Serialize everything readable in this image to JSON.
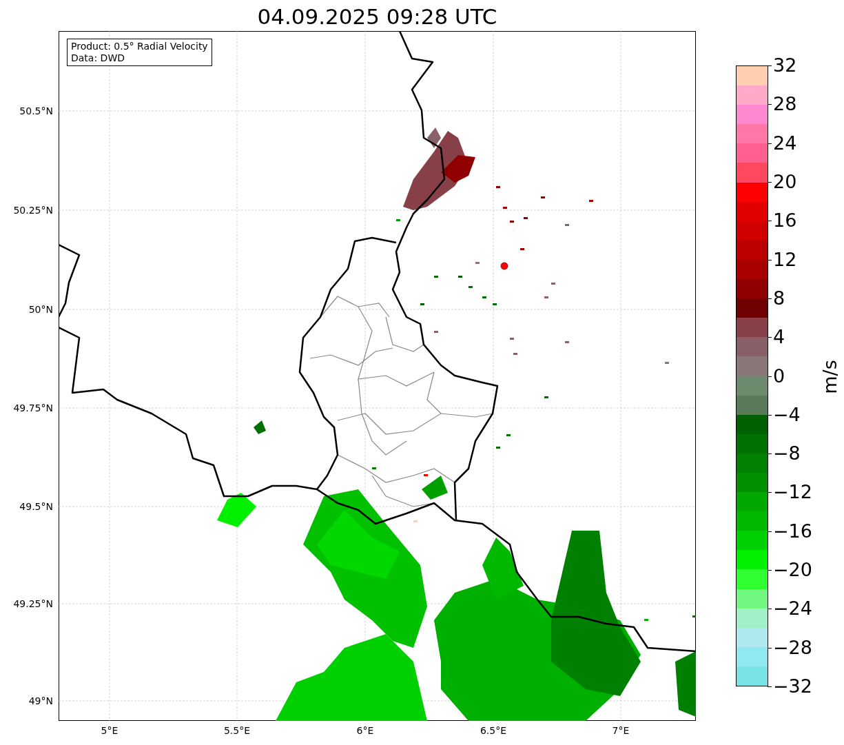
{
  "title": "04.09.2025 09:28 UTC",
  "info_box": {
    "lines": [
      "Product: 0.5° Radial Velocity",
      "Data: DWD"
    ]
  },
  "lat_labels": [
    "50.5°N",
    "50.25°N",
    "50°N",
    "49.75°N",
    "49.5°N",
    "49.25°N",
    "49°N"
  ],
  "lon_labels": [
    "5°E",
    "5.5°E",
    "6°E",
    "6.5°E",
    "7°E"
  ],
  "colorbar": {
    "label": "m/s",
    "ticks": [
      "32",
      "28",
      "24",
      "20",
      "16",
      "12",
      "8",
      "4",
      "0",
      "−4",
      "−8",
      "−12",
      "−16",
      "−20",
      "−24",
      "−28",
      "−32"
    ],
    "bands": [
      {
        "color": "#ffcfb0"
      },
      {
        "color": "#ffaac8"
      },
      {
        "color": "#ff88d0"
      },
      {
        "color": "#ff77a8"
      },
      {
        "color": "#ff6090"
      },
      {
        "color": "#ff4860"
      },
      {
        "color": "#ff0000"
      },
      {
        "color": "#e00000"
      },
      {
        "color": "#d00000"
      },
      {
        "color": "#bb0000"
      },
      {
        "color": "#a80000"
      },
      {
        "color": "#900000"
      },
      {
        "color": "#700000"
      },
      {
        "color": "#884048"
      },
      {
        "color": "#8a6068"
      },
      {
        "color": "#8a7878"
      },
      {
        "color": "#6e8a6e"
      },
      {
        "color": "#5a7a5a"
      },
      {
        "color": "#006000"
      },
      {
        "color": "#007000"
      },
      {
        "color": "#008000"
      },
      {
        "color": "#009000"
      },
      {
        "color": "#00a800"
      },
      {
        "color": "#00b800"
      },
      {
        "color": "#00d000"
      },
      {
        "color": "#00f000"
      },
      {
        "color": "#30ff30"
      },
      {
        "color": "#70f880"
      },
      {
        "color": "#a0f0c8"
      },
      {
        "color": "#b0e8f0"
      },
      {
        "color": "#90e8f0"
      },
      {
        "color": "#78e4e8"
      }
    ]
  }
}
